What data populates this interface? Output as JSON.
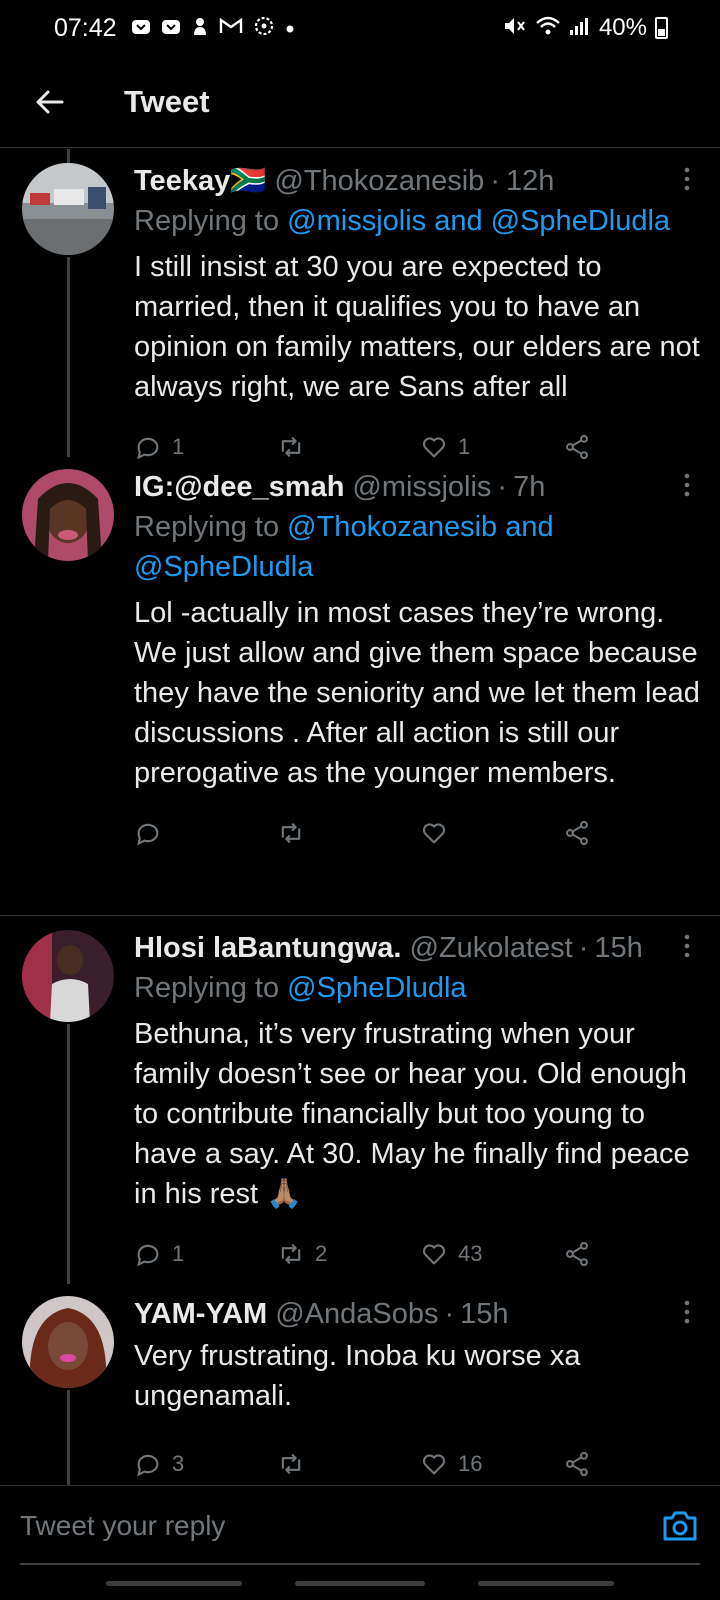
{
  "status_bar": {
    "time": "07:42",
    "battery": "40%",
    "left_icons": [
      "inbox-icon",
      "inbox-icon",
      "hand-icon",
      "gmail-icon",
      "settings-icon",
      "dot-icon"
    ],
    "right_icons": [
      "mute-icon",
      "wifi-icon",
      "signal-icon"
    ]
  },
  "header": {
    "title": "Tweet"
  },
  "tweets": [
    {
      "name": "Teekay🇿🇦",
      "handle": "@Thokozanesib",
      "dot": "·",
      "time": "12h",
      "replying_prefix": "Replying to",
      "replying_links": [
        "@missjolis and @SpheDludla"
      ],
      "text": "I still insist at 30 you are expected to married, then it qualifies you to have an opinion on family matters, our elders are not always right, we are Sans after all",
      "replies": "1",
      "retweets": "",
      "likes": "1"
    },
    {
      "name": "IG:@dee_smah",
      "handle": "@missjolis",
      "dot": "·",
      "time": "7h",
      "replying_prefix": "Replying to",
      "replying_links": [
        "@Thokozanesib and @SpheDludla"
      ],
      "text": "Lol -actually in most cases they’re wrong. We just allow and give them space because they have the seniority and we let them lead discussions . After all action is still our prerogative as the younger members.",
      "replies": "",
      "retweets": "",
      "likes": ""
    },
    {
      "name": "Hlosi laBantungwa.",
      "handle": "@Zukolatest",
      "dot": "·",
      "time": "15h",
      "replying_prefix": "Replying to",
      "replying_links": [
        "@SpheDludla"
      ],
      "text": "Bethuna, it’s very frustrating when your family doesn’t see or hear you. Old enough to contribute financially but too young to have a say. At 30. May he finally find peace in his rest 🙏🏽",
      "replies": "1",
      "retweets": "2",
      "likes": "43"
    },
    {
      "name": "YAM-YAM",
      "handle": "@AndaSobs",
      "dot": "·",
      "time": "15h",
      "replying_prefix": "",
      "replying_links": [],
      "text": "Very frustrating. Inoba ku worse xa ungenamali.",
      "replies": "3",
      "retweets": "",
      "likes": "16"
    }
  ],
  "reply_bar": {
    "placeholder": "Tweet your reply"
  },
  "colors": {
    "background": "#000000",
    "text": "#e7e9ea",
    "muted": "#71767b",
    "link": "#1d9bf0",
    "divider": "#2f3336"
  }
}
